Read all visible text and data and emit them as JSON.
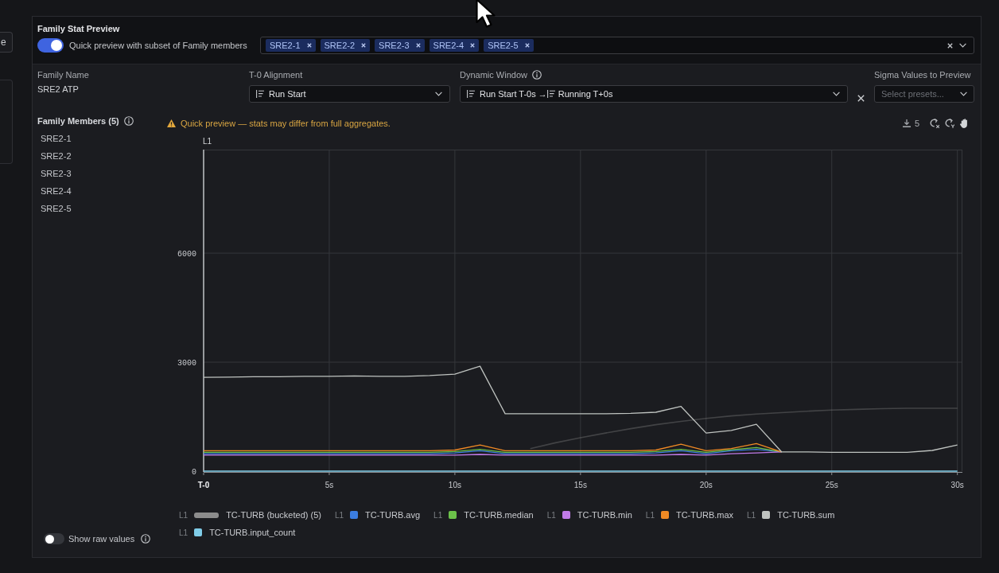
{
  "side_button": {
    "label": "e"
  },
  "panel": {
    "title": "Family Stat Preview"
  },
  "quick_preview": {
    "on": true,
    "label": "Quick preview with subset of Family members",
    "members": [
      "SRE2-1",
      "SRE2-2",
      "SRE2-3",
      "SRE2-4",
      "SRE2-5"
    ]
  },
  "fields": {
    "family_name": {
      "label": "Family Name",
      "value": "SRE2 ATP"
    },
    "t0_alignment": {
      "label": "T-0 Alignment",
      "value": "Run Start"
    },
    "dynamic_window": {
      "label": "Dynamic Window",
      "from": "Run Start T-0s",
      "separator": "→",
      "to": "Running T+0s"
    },
    "sigma_values": {
      "label": "Sigma Values to Preview",
      "placeholder": "Select presets..."
    }
  },
  "family_members": {
    "title": "Family Members (5)",
    "items": [
      "SRE2-1",
      "SRE2-2",
      "SRE2-3",
      "SRE2-4",
      "SRE2-5"
    ]
  },
  "preview": {
    "warning": "Quick preview — stats may differ from full aggregates.",
    "download_count": "5",
    "legend_entries": [
      {
        "axis_label": "L1",
        "kind": "bar"
      },
      {
        "axis_label": "L1",
        "kind": "square"
      },
      {
        "axis_label": "L1",
        "kind": "square"
      },
      {
        "axis_label": "L1",
        "kind": "square"
      },
      {
        "axis_label": "L1",
        "kind": "square"
      },
      {
        "axis_label": "L1",
        "kind": "square"
      },
      {
        "axis_label": "L1",
        "kind": "square"
      }
    ],
    "chart_data": {
      "type": "line",
      "ylabel": "L1",
      "grid": true,
      "legend": "bottom",
      "xlim": [
        0,
        30.2
      ],
      "ylim": [
        0,
        8850
      ],
      "xticks": [
        {
          "value": 0,
          "label": "T-0"
        },
        {
          "value": 5,
          "label": "5s"
        },
        {
          "value": 10,
          "label": "10s"
        },
        {
          "value": 15,
          "label": "15s"
        },
        {
          "value": 20,
          "label": "20s"
        },
        {
          "value": 25,
          "label": "25s"
        },
        {
          "value": 30,
          "label": "30s"
        }
      ],
      "yticks": [
        0,
        3000,
        6000
      ],
      "x": [
        0,
        1,
        2,
        3,
        4,
        5,
        6,
        7,
        8,
        9,
        10,
        11,
        12,
        13,
        14,
        15,
        16,
        17,
        18,
        19,
        20,
        21,
        22,
        23,
        24,
        25,
        26,
        27,
        28,
        29,
        30
      ],
      "series": [
        {
          "name": "TC-TURB (bucketed) (5)",
          "color": "#8c8c8c",
          "values": [
            null,
            null,
            null,
            null,
            null,
            null,
            null,
            null,
            null,
            null,
            null,
            null,
            null,
            620,
            780,
            920,
            1050,
            1170,
            1280,
            1370,
            1450,
            1520,
            1570,
            1610,
            1650,
            1680,
            1700,
            1720,
            1730,
            1730,
            1730
          ]
        },
        {
          "name": "TC-TURB.avg",
          "color": "#3b7de0",
          "values": [
            480,
            480,
            480,
            480,
            480,
            480,
            480,
            480,
            480,
            480,
            500,
            560,
            480,
            480,
            480,
            480,
            480,
            480,
            500,
            560,
            480,
            560,
            600,
            530,
            null,
            null,
            null,
            null,
            null,
            null,
            null
          ]
        },
        {
          "name": "TC-TURB.median",
          "color": "#6cc24a",
          "values": [
            520,
            520,
            520,
            520,
            520,
            520,
            520,
            520,
            520,
            520,
            540,
            600,
            520,
            520,
            520,
            520,
            520,
            520,
            540,
            600,
            520,
            590,
            650,
            530,
            null,
            null,
            null,
            null,
            null,
            null,
            null
          ]
        },
        {
          "name": "TC-TURB.min",
          "color": "#c17be8",
          "values": [
            440,
            440,
            440,
            440,
            440,
            440,
            440,
            440,
            440,
            440,
            440,
            460,
            440,
            440,
            440,
            440,
            440,
            440,
            440,
            460,
            440,
            480,
            500,
            530,
            null,
            null,
            null,
            null,
            null,
            null,
            null
          ]
        },
        {
          "name": "TC-TURB.max",
          "color": "#f08a24",
          "values": [
            560,
            560,
            560,
            560,
            560,
            560,
            560,
            560,
            560,
            560,
            580,
            720,
            560,
            560,
            560,
            560,
            560,
            560,
            580,
            740,
            560,
            620,
            760,
            530,
            null,
            null,
            null,
            null,
            null,
            null,
            null
          ]
        },
        {
          "name": "TC-TURB.sum",
          "color": "#bfc3c0",
          "values": [
            2580,
            2590,
            2600,
            2600,
            2610,
            2610,
            2620,
            2610,
            2610,
            2630,
            2670,
            2890,
            1580,
            1580,
            1580,
            1580,
            1580,
            1590,
            1620,
            1780,
            1050,
            1120,
            1290,
            530,
            530,
            520,
            520,
            520,
            520,
            570,
            720
          ]
        },
        {
          "name": "TC-TURB.input_count",
          "color": "#80cde8",
          "values": [
            0,
            0,
            0,
            0,
            0,
            0,
            0,
            0,
            0,
            0,
            0,
            0,
            0,
            0,
            0,
            0,
            0,
            0,
            0,
            0,
            0,
            0,
            0,
            0,
            0,
            0,
            0,
            0,
            0,
            0,
            0
          ]
        }
      ]
    }
  },
  "show_raw_values": {
    "on": false,
    "label": "Show raw values"
  }
}
